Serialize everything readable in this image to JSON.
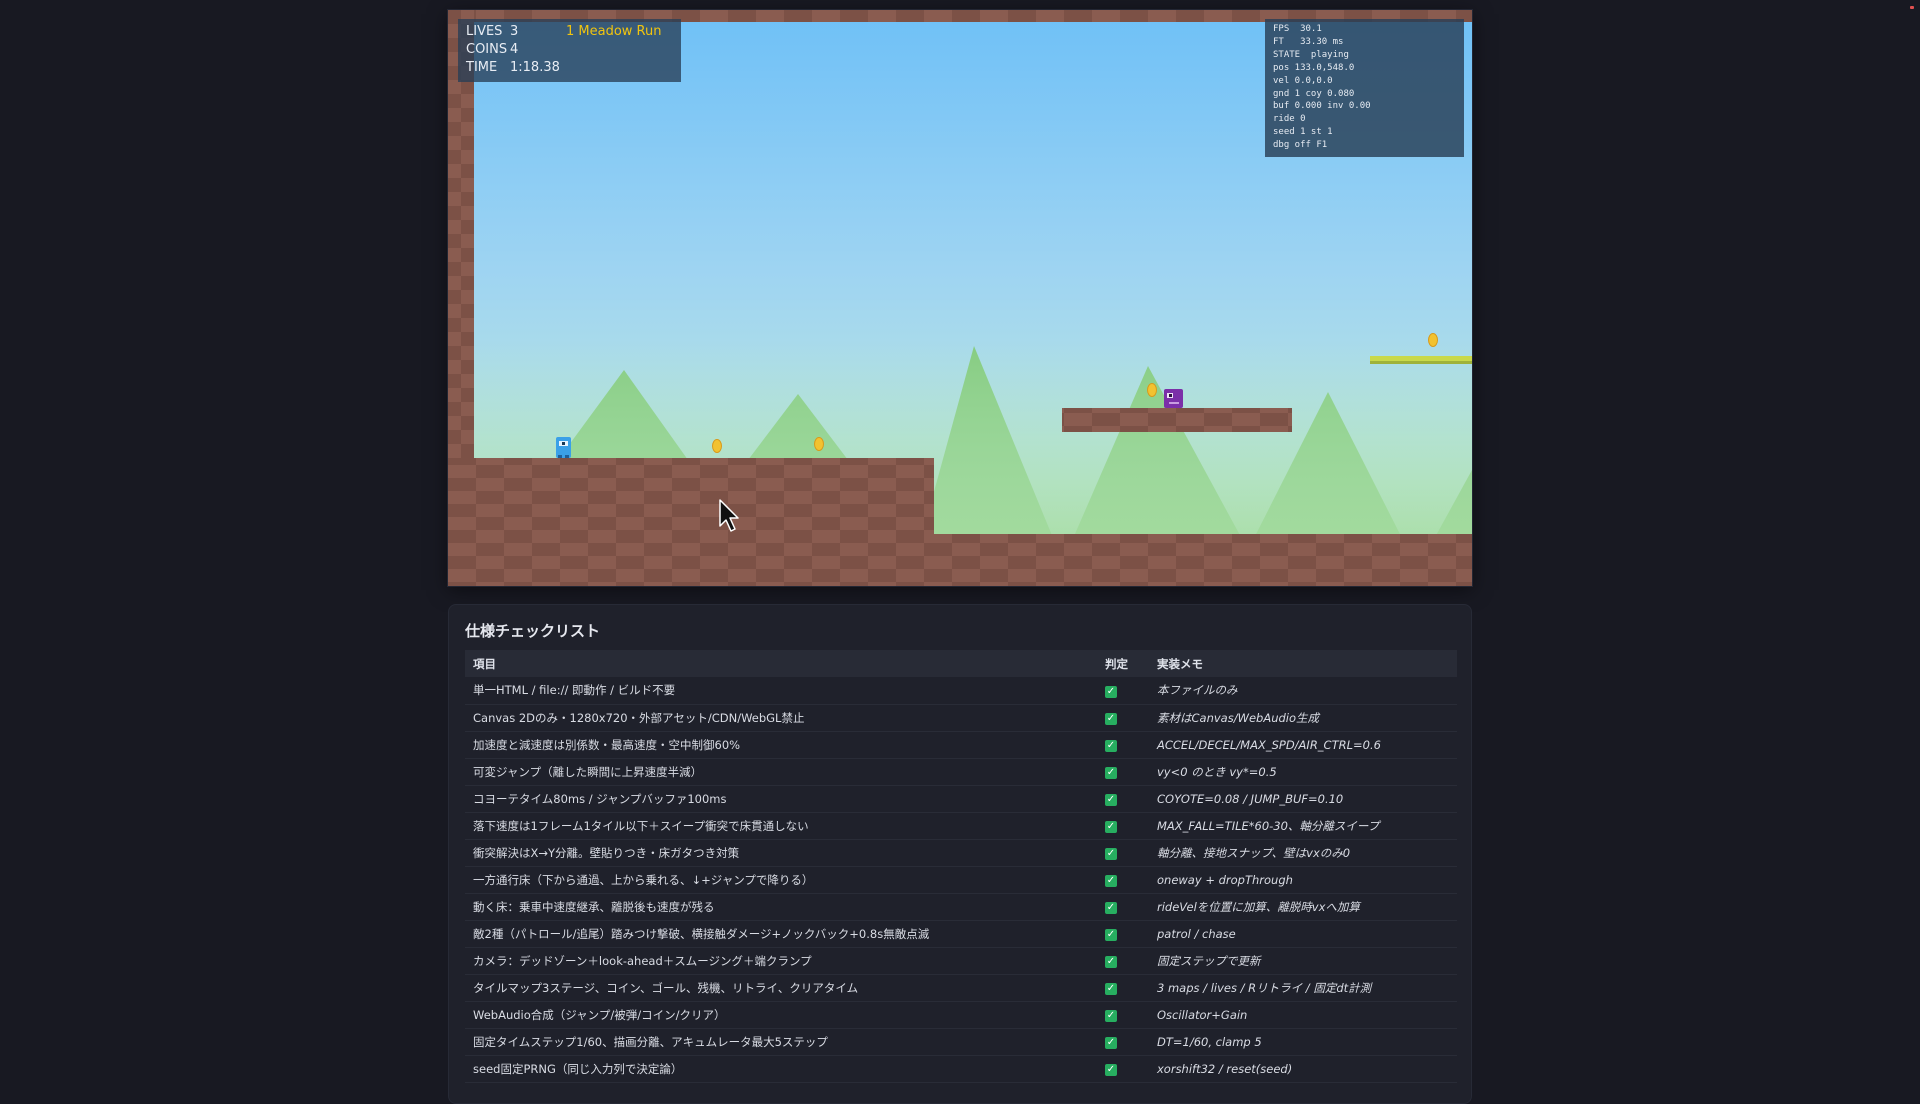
{
  "hud": {
    "lives_label": "LIVES",
    "lives": "3",
    "coins_label": "COINS",
    "coins": "4",
    "time_label": "TIME",
    "time": "1:18.38",
    "level": "1 Meadow Run"
  },
  "debug": {
    "fps": "FPS  30.1",
    "ft": "FT   33.30 ms",
    "state": "STATE  playing",
    "pos": "pos 133.0,548.0",
    "vel": "vel 0.0,0.0",
    "gnd": "gnd 1 coy 0.080",
    "buf": "buf 0.000 inv 0.00",
    "ride": "ride 0",
    "seed": "seed 1 st 1",
    "dbg": "dbg off F1"
  },
  "colors": {
    "page_bg": "#181922",
    "sky_top": "#6ec0f7",
    "sky_bottom": "#b6e2e4",
    "ground_light": "#8c5e51",
    "ground_dark": "#7a5046",
    "tree": "#7ec67a",
    "coin": "#f2c230",
    "player": "#3aa0e8",
    "enemy": "#7b2fa8",
    "hud_accent": "#f1c40f",
    "check": "#27ae60"
  },
  "checklist": {
    "title": "仕様チェックリスト",
    "headers": {
      "item": "項目",
      "judge": "判定",
      "memo": "実装メモ"
    },
    "rows": [
      {
        "item": "単一HTML / file:// 即動作 / ビルド不要",
        "memo": "本ファイルのみ"
      },
      {
        "item": "Canvas 2Dのみ・1280x720・外部アセット/CDN/WebGL禁止",
        "memo": "素材はCanvas/WebAudio生成"
      },
      {
        "item": "加速度と減速度は別係数・最高速度・空中制御60%",
        "memo": "ACCEL/DECEL/MAX_SPD/AIR_CTRL=0.6"
      },
      {
        "item": "可変ジャンプ（離した瞬間に上昇速度半減）",
        "memo": "vy<0 のとき vy*=0.5"
      },
      {
        "item": "コヨーテタイム80ms / ジャンプバッファ100ms",
        "memo": "COYOTE=0.08 / JUMP_BUF=0.10"
      },
      {
        "item": "落下速度は1フレーム1タイル以下＋スイープ衝突で床貫通しない",
        "memo": "MAX_FALL=TILE*60-30、軸分離スイープ"
      },
      {
        "item": "衝突解決はX→Y分離。壁貼りつき・床ガタつき対策",
        "memo": "軸分離、接地スナップ、壁はvxのみ0"
      },
      {
        "item": "一方通行床（下から通過、上から乗れる、↓+ジャンプで降りる）",
        "memo": "oneway + dropThrough"
      },
      {
        "item": "動く床：乗車中速度継承、離脱後も速度が残る",
        "memo": "rideVelを位置に加算、離脱時vxへ加算"
      },
      {
        "item": "敵2種（パトロール/追尾）踏みつけ撃破、横接触ダメージ+ノックバック+0.8s無敵点滅",
        "memo": "patrol / chase"
      },
      {
        "item": "カメラ：デッドゾーン＋look-ahead＋スムージング＋端クランプ",
        "memo": "固定ステップで更新"
      },
      {
        "item": "タイルマップ3ステージ、コイン、ゴール、残機、リトライ、クリアタイム",
        "memo": "3 maps / lives / Rリトライ / 固定dt計測"
      },
      {
        "item": "WebAudio合成（ジャンプ/被弾/コイン/クリア）",
        "memo": "Oscillator+Gain"
      },
      {
        "item": "固定タイムステップ1/60、描画分離、アキュムレータ最大5ステップ",
        "memo": "DT=1/60, clamp 5"
      },
      {
        "item": "seed固定PRNG（同じ入力列で決定論）",
        "memo": "xorshift32 / reset(seed)"
      }
    ]
  }
}
